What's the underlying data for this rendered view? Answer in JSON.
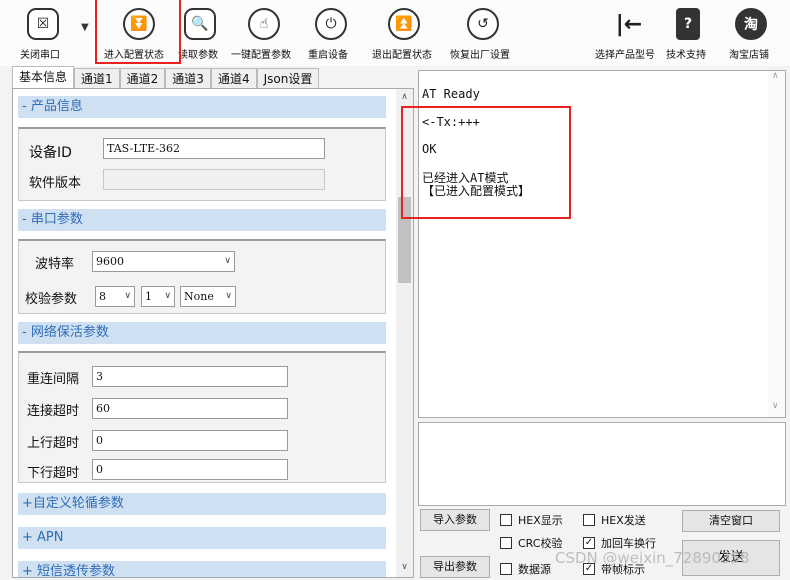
{
  "toolbar": {
    "buttons": [
      {
        "label": "关闭串口",
        "icon": "☒"
      },
      {
        "label": "进入配置状态",
        "icon": "⏬"
      },
      {
        "label": "读取参数",
        "icon": "🔍"
      },
      {
        "label": "一键配置参数",
        "icon": "☝"
      },
      {
        "label": "重启设备",
        "icon": "⏻"
      },
      {
        "label": "退出配置状态",
        "icon": "⏫"
      },
      {
        "label": "恢复出厂设置",
        "icon": "↺"
      },
      {
        "label": "选择产品型号",
        "icon": "|←"
      },
      {
        "label": "技术支持",
        "icon": "?"
      },
      {
        "label": "淘宝店铺",
        "icon": "淘"
      }
    ],
    "dropdown_arrow": "▼"
  },
  "tabs": [
    "基本信息",
    "通道1",
    "通道2",
    "通道3",
    "通道4",
    "Json设置"
  ],
  "left": {
    "product": {
      "header": "- 产品信息",
      "device_id_label": "设备ID",
      "device_id": "TAS-LTE-362",
      "firmware_label": "软件版本",
      "firmware": ""
    },
    "serial": {
      "header": "- 串口参数",
      "baud_label": "波特率",
      "baud": "9600",
      "parity_label": "校验参数",
      "data_bits": "8",
      "stop_bits": "1",
      "parity": "None"
    },
    "keepalive": {
      "header": "- 网络保活参数",
      "reconnect_label": "重连间隔",
      "reconnect": "3",
      "conn_timeout_label": "连接超时",
      "conn_timeout": "60",
      "up_timeout_label": "上行超时",
      "up_timeout": "0",
      "down_timeout_label": "下行超时",
      "down_timeout": "0"
    },
    "custom_poll": {
      "header": "+自定义轮循参数"
    },
    "apn": {
      "header": "+ APN"
    },
    "sms": {
      "header": "+ 短信透传参数"
    }
  },
  "output": {
    "lines": [
      "AT Ready",
      "<-Tx:+++",
      "OK",
      "已经进入AT模式",
      "【已进入配置模式】"
    ]
  },
  "bottom": {
    "import_label": "导入参数",
    "export_label": "导出参数",
    "hex_display": "HEX显示",
    "hex_send": "HEX发送",
    "crc_check": "CRC校验",
    "add_crlf": "加回车换行",
    "data_source": "数据源",
    "with_flag": "带帧标示",
    "clear_label": "清空窗口",
    "send_label": "发送",
    "checks": {
      "hex_display": false,
      "hex_send": false,
      "crc_check": false,
      "add_crlf": true,
      "data_source": false,
      "with_flag": true
    }
  },
  "watermark": "CSDN @weixin_72890358",
  "colors": {
    "highlight": "#e8231f",
    "section_bg": "#cfe0f3",
    "section_text": "#2f6db5"
  }
}
